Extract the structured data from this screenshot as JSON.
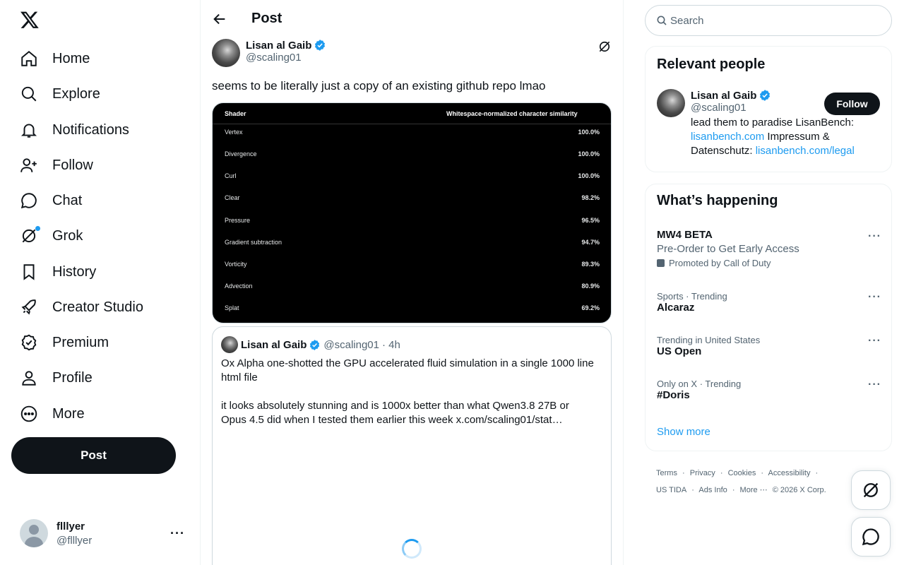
{
  "nav": {
    "items": [
      {
        "label": "Home",
        "icon": "home-icon"
      },
      {
        "label": "Explore",
        "icon": "search-icon"
      },
      {
        "label": "Notifications",
        "icon": "bell-icon"
      },
      {
        "label": "Follow",
        "icon": "person-add-icon"
      },
      {
        "label": "Chat",
        "icon": "chat-icon"
      },
      {
        "label": "Grok",
        "icon": "grok-icon"
      },
      {
        "label": "History",
        "icon": "bookmark-icon"
      },
      {
        "label": "Creator Studio",
        "icon": "rocket-icon"
      },
      {
        "label": "Premium",
        "icon": "verified-badge-icon"
      },
      {
        "label": "Profile",
        "icon": "person-icon"
      },
      {
        "label": "More",
        "icon": "more-circle-icon"
      }
    ],
    "post_button": "Post",
    "account": {
      "name": "flllyer",
      "handle": "@flllyer"
    }
  },
  "main": {
    "title": "Post",
    "author": {
      "name": "Lisan al Gaib",
      "handle": "@scaling01"
    },
    "text": "seems to be literally just a copy of an existing github repo lmao",
    "media_table": {
      "headers": [
        "Shader",
        "Whitespace-normalized character similarity"
      ],
      "rows": [
        {
          "name": "Vertex",
          "value": "100.0%"
        },
        {
          "name": "Divergence",
          "value": "100.0%"
        },
        {
          "name": "Curl",
          "value": "100.0%"
        },
        {
          "name": "Clear",
          "value": "98.2%"
        },
        {
          "name": "Pressure",
          "value": "96.5%"
        },
        {
          "name": "Gradient subtraction",
          "value": "94.7%"
        },
        {
          "name": "Vorticity",
          "value": "89.3%"
        },
        {
          "name": "Advection",
          "value": "80.9%"
        },
        {
          "name": "Splat",
          "value": "69.2%"
        }
      ]
    },
    "quote": {
      "name": "Lisan al Gaib",
      "handle": "@scaling01",
      "time": "· 4h",
      "para1": "Ox Alpha one-shotted the GPU accelerated fluid simulation in a single 1000 line html file",
      "para2": "it looks absolutely stunning and is 1000x better than what Qwen3.8 27B or Opus 4.5 did when I tested them earlier this week  x.com/scaling01/stat…"
    }
  },
  "sidebar": {
    "search_placeholder": "Search",
    "relevant": {
      "title": "Relevant people",
      "name": "Lisan al Gaib",
      "handle": "@scaling01",
      "follow": "Follow",
      "bio_1": "lead them to paradise LisanBench:",
      "bio_link1": "lisanbench.com",
      "bio_2": " Impressum & Datenschutz: ",
      "bio_link2": "lisanbench.com/legal"
    },
    "happening": {
      "title": "What’s happening",
      "promo": {
        "title": "MW4 BETA",
        "sub": "Pre-Order to Get Early Access",
        "promoted": "Promoted by Call of Duty"
      },
      "trends": [
        {
          "context": "Sports · Trending",
          "title": "Alcaraz"
        },
        {
          "context": "Trending in United States",
          "title": "US Open"
        },
        {
          "context": "Only on X · Trending",
          "title": "#Doris"
        }
      ],
      "show_more": "Show more"
    },
    "footer": {
      "links": [
        "Terms",
        "·",
        "Privacy",
        "·",
        "Cookies",
        "·",
        "Accessibility",
        "·",
        "US TIDA",
        "·",
        "Ads Info",
        "·",
        "More ⋯",
        "© 2026 X Corp."
      ]
    }
  }
}
